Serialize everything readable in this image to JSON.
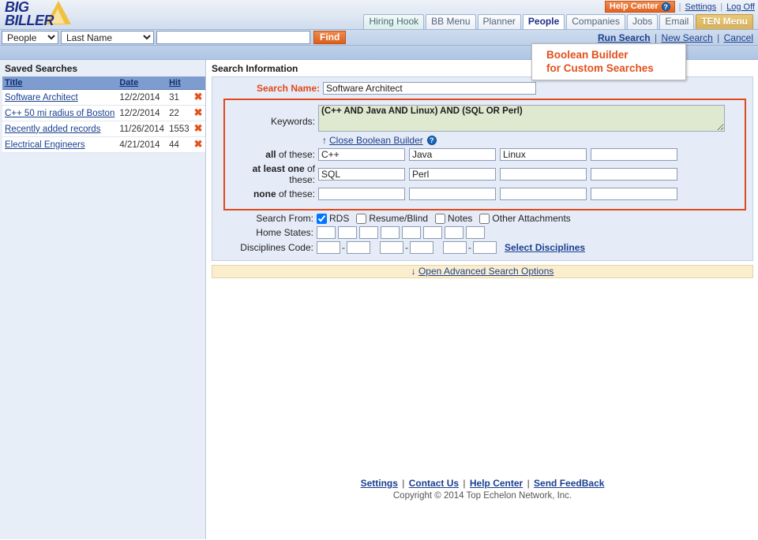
{
  "brand": {
    "line1": "BIG",
    "line2": "BILLER"
  },
  "header": {
    "help_center": "Help Center",
    "help_icon_glyph": "?",
    "settings": "Settings",
    "log_off": "Log Off",
    "tabs": [
      {
        "label": "Hiring Hook",
        "state": "hiring"
      },
      {
        "label": "BB Menu",
        "state": "normal"
      },
      {
        "label": "Planner",
        "state": "normal"
      },
      {
        "label": "People",
        "state": "active"
      },
      {
        "label": "Companies",
        "state": "normal"
      },
      {
        "label": "Jobs",
        "state": "normal"
      },
      {
        "label": "Email",
        "state": "normal"
      },
      {
        "label": "TEN Menu",
        "state": "ten"
      }
    ]
  },
  "quicksearch": {
    "module": "People",
    "field": "Last Name",
    "query_value": "",
    "query_placeholder": "",
    "find_label": "Find"
  },
  "action_links": {
    "run_search": "Run Search",
    "new_search": "New Search",
    "cancel": "Cancel",
    "separator": "|"
  },
  "sidebar": {
    "title": "Saved Searches",
    "columns": {
      "title": "Title",
      "date": "Date",
      "hit": "Hit"
    },
    "rows": [
      {
        "title": "Software Architect",
        "date": "12/2/2014",
        "hit": "31",
        "delete": "✖"
      },
      {
        "title": "C++ 50 mi radius of Boston",
        "date": "12/2/2014",
        "hit": "22",
        "delete": "✖"
      },
      {
        "title": "Recently added records",
        "date": "11/26/2014",
        "hit": "1553",
        "delete": "✖"
      },
      {
        "title": "Electrical Engineers",
        "date": "4/21/2014",
        "hit": "44",
        "delete": "✖"
      }
    ]
  },
  "main": {
    "title": "Search Information",
    "search_name_label": "Search Name:",
    "search_name_value": "Software Architect",
    "keywords_label": "Keywords:",
    "keywords_value": "(C++ AND Java AND Linux) AND (SQL OR Perl)",
    "close_builder_arrow": "↑",
    "close_builder_label": "Close Boolean Builder",
    "help_icon_glyph": "?",
    "boolean_rows": [
      {
        "strong": "all",
        "rest": " of these:",
        "values": [
          "C++",
          "Java",
          "Linux",
          ""
        ]
      },
      {
        "strong": "at least one",
        "rest": " of these:",
        "values": [
          "SQL",
          "Perl",
          "",
          ""
        ]
      },
      {
        "strong": "none",
        "rest": " of these:",
        "values": [
          "",
          "",
          "",
          ""
        ]
      }
    ],
    "search_from_label": "Search From:",
    "search_from_options": [
      {
        "label": "RDS",
        "checked": true
      },
      {
        "label": "Resume/Blind",
        "checked": false
      },
      {
        "label": "Notes",
        "checked": false
      },
      {
        "label": "Other Attachments",
        "checked": false
      }
    ],
    "home_states_label": "Home States:",
    "home_states_values": [
      "",
      "",
      "",
      "",
      "",
      "",
      "",
      ""
    ],
    "disciplines_label": "Disciplines Code:",
    "disciplines_pairs": [
      {
        "a": "",
        "b": ""
      },
      {
        "a": "",
        "b": ""
      },
      {
        "a": "",
        "b": ""
      }
    ],
    "disciplines_dash": "-",
    "select_disciplines": "Select Disciplines",
    "advanced_arrow": "↓",
    "advanced_label": "Open Advanced Search Options"
  },
  "callout": {
    "line1": "Boolean Builder",
    "line2": "for Custom Searches"
  },
  "footer": {
    "links": [
      "Settings",
      "Contact Us",
      "Help Center",
      "Send FeedBack"
    ],
    "separator": "|",
    "copyright": "Copyright © 2014 Top Echelon Network, Inc."
  },
  "colors": {
    "accent_orange": "#e0491a",
    "link_blue": "#1a3f8f",
    "brand_blue": "#1c2f86",
    "gold": "#d9b259",
    "keyword_bg": "#dfe9cf"
  }
}
